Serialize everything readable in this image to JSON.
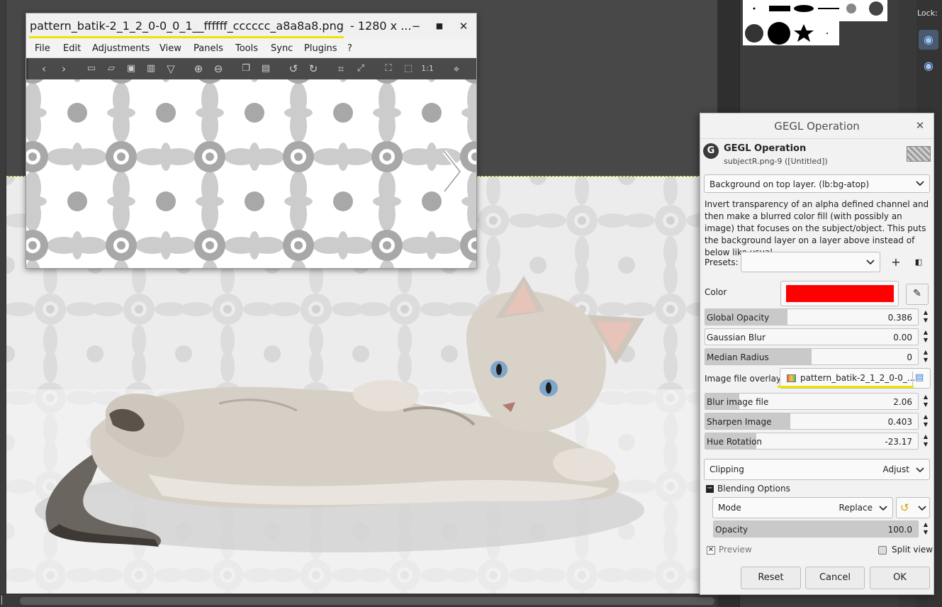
{
  "viewer": {
    "title": "pattern_batik-2_1_2_0-0_0_1__ffffff_cccccc_a8a8a8.png",
    "dims": "- 1280 x ...",
    "minimize_icon": "minimize-icon",
    "maximize_icon": "maximize-icon",
    "close_icon": "close-icon",
    "menu": [
      "File",
      "Edit",
      "Adjustments",
      "View",
      "Panels",
      "Tools",
      "Sync",
      "Plugins",
      "?"
    ],
    "toolbar_icons": [
      "back-icon",
      "forward-icon",
      "new-icon",
      "open-icon",
      "save-icon",
      "delete-icon",
      "filter-icon",
      "zoom-in-icon",
      "zoom-out-icon",
      "copy-icon",
      "paste-icon",
      "rotate-left-icon",
      "rotate-right-icon",
      "crop-icon",
      "resize-icon",
      "fullscreen-icon",
      "fit-icon",
      "actual-size-icon",
      "location-icon"
    ],
    "actual_size_label": "1:1"
  },
  "lock": {
    "label": "Lock:"
  },
  "gegl": {
    "window_title": "GEGL Operation",
    "op_name": "GEGL Operation",
    "op_subtitle": "subjectR.png-9 ([Untitled])",
    "filter": "Background on top layer. (lb:bg-atop)",
    "description": "Invert transparency of an alpha defined channel and then make a blurred color fill (with possibly an image) that focuses on the subject/object. This puts the background layer on a layer above instead of below like usual.",
    "presets_label": "Presets:",
    "presets_value": "",
    "color_label": "Color",
    "color_value": "#ff0000",
    "sliders": [
      {
        "label": "Global Opacity",
        "value": "0.386",
        "fraction": 0.386
      },
      {
        "label": "Gaussian Blur",
        "value": "0.00",
        "fraction": 0.0
      },
      {
        "label": "Median Radius",
        "value": "0",
        "fraction": 0.5
      },
      {
        "label": "Blur image file",
        "value": "2.06",
        "fraction": 0.16
      },
      {
        "label": "Sharpen Image",
        "value": "0.403",
        "fraction": 0.4
      },
      {
        "label": "Hue Rotation",
        "value": "-23.17",
        "fraction": 0.24
      }
    ],
    "image_overlay_label": "Image file overlay",
    "image_overlay_value": "pattern_batik-2_1_2_0-0_...",
    "clipping_label": "Clipping",
    "clipping_value": "Adjust",
    "blending_label": "Blending Options",
    "mode_label": "Mode",
    "mode_value": "Replace",
    "opacity_label": "Opacity",
    "opacity_value": "100.0",
    "opacity_fraction": 1.0,
    "preview_label": "Preview",
    "split_view_label": "Split view",
    "reset": "Reset",
    "cancel": "Cancel",
    "ok": "OK"
  }
}
